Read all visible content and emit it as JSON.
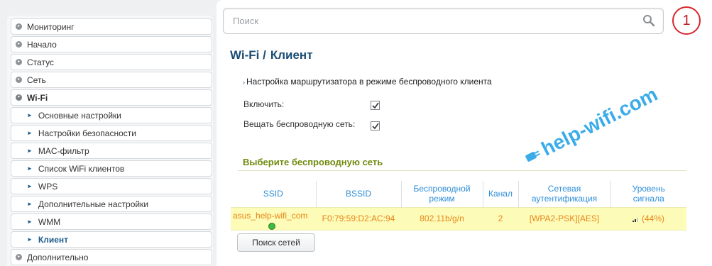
{
  "sidebar": {
    "items": [
      {
        "label": "Мониторинг"
      },
      {
        "label": "Начало"
      },
      {
        "label": "Статус"
      },
      {
        "label": "Сеть"
      },
      {
        "label": "Wi-Fi"
      }
    ],
    "wifi_sub": [
      {
        "label": "Основные настройки"
      },
      {
        "label": "Настройки безопасности"
      },
      {
        "label": "MAC-фильтр"
      },
      {
        "label": "Список WiFi клиентов"
      },
      {
        "label": "WPS"
      },
      {
        "label": "Дополнительные настройки"
      },
      {
        "label": "WMM"
      },
      {
        "label": "Клиент"
      }
    ],
    "bottom": {
      "label": "Дополнительно"
    }
  },
  "search": {
    "placeholder": "Поиск"
  },
  "badge": "1",
  "page": {
    "title_section": "Wi-Fi /",
    "title_page": "Клиент",
    "description": "Настройка маршрутизатора в режиме беспроводного клиента",
    "enable_label": "Включить:",
    "broadcast_label": "Вещать беспроводную сеть:"
  },
  "networks": {
    "title": "Выберите беспроводную сеть",
    "headers": {
      "ssid": "SSID",
      "bssid": "BSSID",
      "mode_1": "Беспроводной",
      "mode_2": "режим",
      "channel": "Канал",
      "auth_1": "Сетевая",
      "auth_2": "аутентификация",
      "signal_1": "Уровень",
      "signal_2": "сигнала"
    },
    "rows": [
      {
        "ssid": "asus_help-wifi_com",
        "bssid": "F0:79:59:D2:AC:94",
        "mode": "802.11b/g/n",
        "channel": "2",
        "auth": "[WPA2-PSK][AES]",
        "signal": "(44%)"
      }
    ],
    "scan_button": "Поиск сетей"
  },
  "watermark": "help-wifi.com"
}
